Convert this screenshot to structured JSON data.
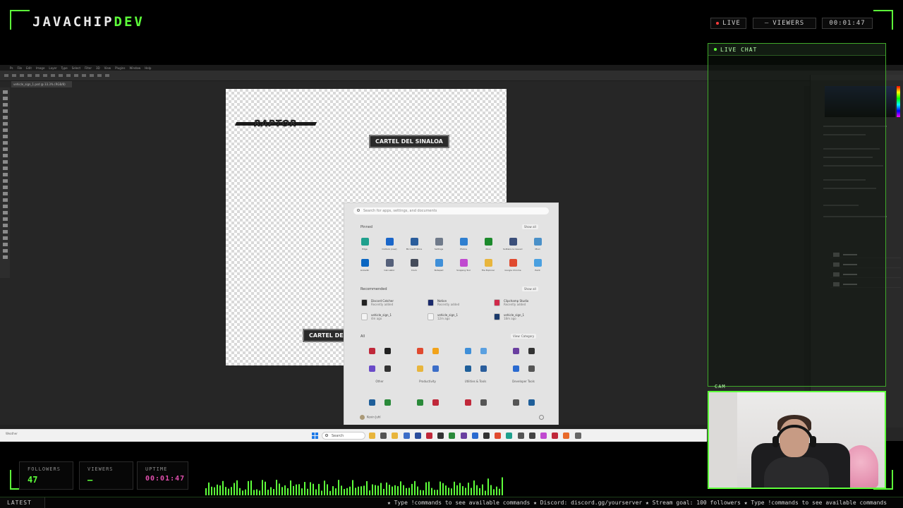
{
  "overlay": {
    "brand": {
      "main": "JAVACHIP",
      "accent": "DEV"
    },
    "pills": {
      "live": "LIVE",
      "viewers_dash": "–",
      "viewers": "VIEWERS",
      "time": "00:01:47"
    },
    "chat_title": "LIVE CHAT",
    "cam_label": "CAM",
    "stats": {
      "followers_label": "FOLLOWERS",
      "followers_value": "47",
      "viewers_label": "VIEWERS",
      "viewers_value": "–",
      "uptime_label": "UPTIME",
      "uptime_value": "00:01:47"
    },
    "ticker_label": "LATEST",
    "ticker_text": "★ Type !commands to see available commands ★ Discord: discord.gg/yourserver ★ Stream goal: 100 followers ★ Type !commands to see available commands",
    "accent_color": "#5dff3a"
  },
  "photoshop": {
    "menu": [
      "Ps",
      "File",
      "Edit",
      "Image",
      "Layer",
      "Type",
      "Select",
      "Filter",
      "3D",
      "View",
      "Plugins",
      "Window",
      "Help"
    ],
    "doc_tab": "vehicle_sign_1.psd @ 33.3% (RGB/8)",
    "canvas": {
      "logo_text": "RAPTOR",
      "label_1": "CARTEL DEL SINALOA",
      "label_2": "CARTEL DEL SINALOA"
    }
  },
  "start_menu": {
    "search_placeholder": "Search for apps, settings, and documents",
    "pinned_label": "Pinned",
    "show_all": "Show all",
    "pinned": [
      {
        "name": "Edge",
        "color": "#1fa08d"
      },
      {
        "name": "Outlook (new)",
        "color": "#1a66c9"
      },
      {
        "name": "Microsoft Store",
        "color": "#2a5d9c"
      },
      {
        "name": "Settings",
        "color": "#6f7a8a"
      },
      {
        "name": "Photos",
        "color": "#2f7fd0"
      },
      {
        "name": "Xbox",
        "color": "#1c8a2c"
      },
      {
        "name": "Solitaire & Casual Games",
        "color": "#3b4f7a"
      },
      {
        "name": "Movi",
        "color": "#4a90c8"
      },
      {
        "name": "LinkedIn",
        "color": "#0a66c2"
      },
      {
        "name": "Calculator",
        "color": "#55607a"
      },
      {
        "name": "Clock",
        "color": "#444b5a"
      },
      {
        "name": "Notepad",
        "color": "#3f8fd8"
      },
      {
        "name": "Snipping Tool",
        "color": "#c04ad0"
      },
      {
        "name": "File Explorer",
        "color": "#e8b53c"
      },
      {
        "name": "Google Chrome",
        "color": "#e04a2f"
      },
      {
        "name": "Paint",
        "color": "#4aa0e0"
      }
    ],
    "recommended_label": "Recommended",
    "recommended": [
      {
        "title": "Discord Catcher",
        "sub": "Recently added",
        "color": "#222"
      },
      {
        "title": "Notion",
        "sub": "Recently added",
        "color": "#1b2a6b"
      },
      {
        "title": "Clipchamp Studio",
        "sub": "Recently added",
        "color": "#d02a4a"
      },
      {
        "title": "vehicle_sign_1",
        "sub": "4m ago",
        "color": "#f4f4f4"
      },
      {
        "title": "vehicle_sign_1",
        "sub": "12m ago",
        "color": "#f4f4f4"
      },
      {
        "title": "vehicle_sign_1",
        "sub": "18m ago",
        "color": "#1b3a6b"
      }
    ],
    "all_label": "All",
    "view_label": "View: Category",
    "categories": [
      "Other",
      "Productivity",
      "Utilities & Tools",
      "Developer Tools"
    ],
    "user_name": "Kevin Juhl"
  },
  "taskbar": {
    "search_label": "Search",
    "tray_text": "Weather"
  }
}
